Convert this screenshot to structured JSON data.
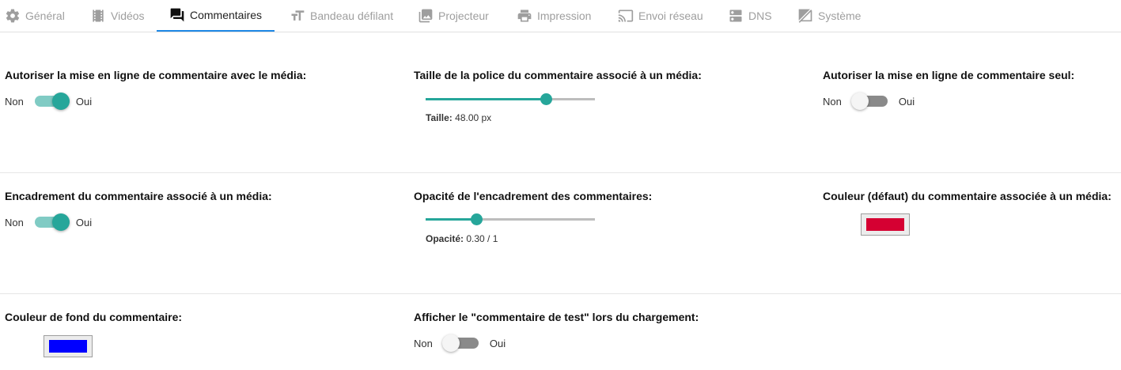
{
  "tabs": [
    {
      "label": "Général",
      "icon": "gear-icon"
    },
    {
      "label": "Vidéos",
      "icon": "film-icon"
    },
    {
      "label": "Commentaires",
      "icon": "comments-icon",
      "active": true
    },
    {
      "label": "Bandeau défilant",
      "icon": "text-size-icon"
    },
    {
      "label": "Projecteur",
      "icon": "images-icon"
    },
    {
      "label": "Impression",
      "icon": "printer-icon"
    },
    {
      "label": "Envoi réseau",
      "icon": "cast-icon"
    },
    {
      "label": "DNS",
      "icon": "dns-icon"
    },
    {
      "label": "Système",
      "icon": "no-signal-icon"
    }
  ],
  "colors": {
    "accent": "#26a69a",
    "tab_underline": "#1e88e5",
    "default_comment_color": "#d50032",
    "comment_background_color": "#0000ff"
  },
  "settings": {
    "upload_with_media": {
      "label": "Autoriser la mise en ligne de commentaire avec le média:",
      "off_label": "Non",
      "on_label": "Oui",
      "value": true
    },
    "font_size": {
      "label": "Taille de la police du commentaire associé à un média:",
      "caption_label": "Taille:",
      "caption_value": "48.00 px",
      "level": 0.71
    },
    "upload_alone": {
      "label": "Autoriser la mise en ligne de commentaire seul:",
      "off_label": "Non",
      "on_label": "Oui",
      "value": false
    },
    "frame": {
      "label": "Encadrement du commentaire associé à un média:",
      "off_label": "Non",
      "on_label": "Oui",
      "value": true
    },
    "frame_opacity": {
      "label": "Opacité de l'encadrement des commentaires:",
      "caption_label": "Opacité:",
      "caption_value": "0.30 / 1",
      "level": 0.3
    },
    "default_color": {
      "label": "Couleur (défaut) du commentaire associée à un média:"
    },
    "background_color": {
      "label": "Couleur de fond du commentaire:"
    },
    "show_test_comment": {
      "label": "Afficher le \"commentaire de test\" lors du chargement:",
      "off_label": "Non",
      "on_label": "Oui",
      "value": false
    }
  }
}
